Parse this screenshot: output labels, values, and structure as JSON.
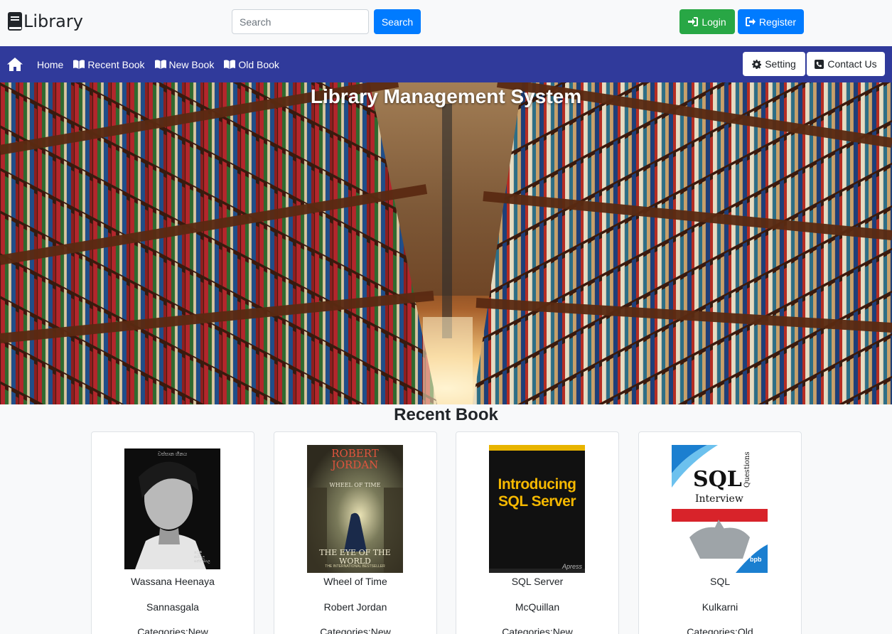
{
  "header": {
    "brand": "Library",
    "search_placeholder": "Search",
    "search_button": "Search",
    "login_button": "Login",
    "register_button": "Register"
  },
  "nav": {
    "links": [
      {
        "label": "Home",
        "icon": "home-icon"
      },
      {
        "label": "Recent Book",
        "icon": "book-open-icon"
      },
      {
        "label": "New Book",
        "icon": "book-open-icon"
      },
      {
        "label": "Old Book",
        "icon": "book-open-icon"
      }
    ],
    "setting_button": "Setting",
    "contact_button": "Contact Us",
    "bg_color": "#303a9b"
  },
  "hero": {
    "title": "Library Management System"
  },
  "recent": {
    "title": "Recent Book",
    "books": [
      {
        "title": "Wassana Heenaya",
        "author": "Sannasgala",
        "category": "Categories:New",
        "cover_text": [
          "වස්සාන හීනය",
          "ධෙලී",
          "ආරියල",
          "සන්නස්ගල"
        ]
      },
      {
        "title": "Wheel of Time",
        "author": "Robert Jordan",
        "category": "Categories:New",
        "cover_text": [
          "ROBERT",
          "JORDAN",
          "WHEEL OF TIME",
          "THE EYE OF THE WORLD",
          "THE INTERNATIONAL BESTSELLER"
        ]
      },
      {
        "title": "SQL Server",
        "author": "McQuillan",
        "category": "Categories:New",
        "cover_text": [
          "Introducing",
          "SQL Server",
          "Apress"
        ]
      },
      {
        "title": "SQL",
        "author": "Kulkarni",
        "category": "Categories:Old",
        "cover_text": [
          "SQL",
          "Interview",
          "Questions",
          "bpb"
        ]
      }
    ]
  },
  "colors": {
    "primary": "#007bff",
    "success": "#28a745",
    "navbar": "#303a9b"
  }
}
